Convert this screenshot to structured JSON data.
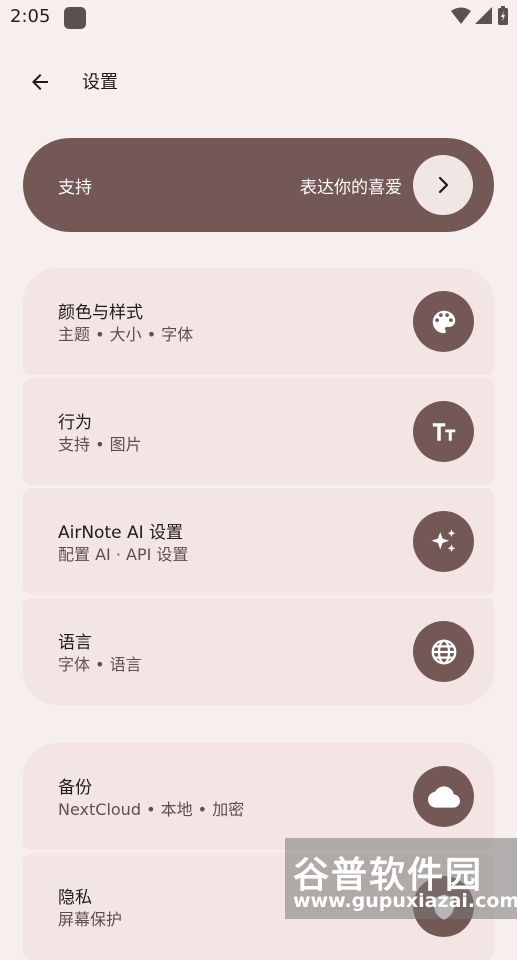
{
  "status_bar": {
    "time": "2:05"
  },
  "header": {
    "title": "设置"
  },
  "support": {
    "label": "支持",
    "subtitle": "表达你的喜爱"
  },
  "settings_groups": [
    {
      "items": [
        {
          "title": "颜色与样式",
          "subtitle": "主题 • 大小 • 字体",
          "icon": "palette-icon"
        },
        {
          "title": "行为",
          "subtitle": "支持 • 图片",
          "icon": "text-size-icon"
        },
        {
          "title": "AirNote AI 设置",
          "subtitle": "配置 AI · API 设置",
          "icon": "sparkle-icon"
        },
        {
          "title": "语言",
          "subtitle": "字体 • 语言",
          "icon": "globe-icon"
        }
      ]
    },
    {
      "items": [
        {
          "title": "备份",
          "subtitle": "NextCloud • 本地 • 加密",
          "icon": "cloud-icon"
        },
        {
          "title": "隐私",
          "subtitle": "屏幕保护",
          "icon": "privacy-icon"
        }
      ]
    }
  ],
  "watermark": {
    "line1": "谷普软件园",
    "line2": "www.gupuxiazai.com"
  },
  "colors": {
    "background": "#f7efed",
    "accent": "#735856",
    "card": "#f2e5e3"
  }
}
